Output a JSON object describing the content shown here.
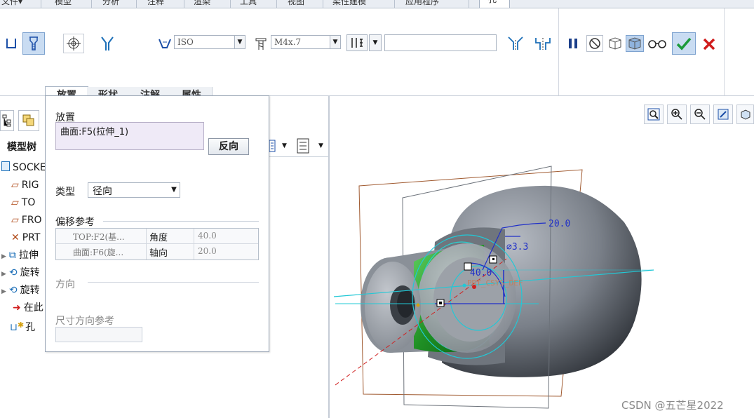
{
  "menu": {
    "tabs": [
      "文件▾",
      "模型",
      "分析",
      "注释",
      "渲染",
      "工具",
      "视图",
      "柔性建模",
      "应用程序",
      "孔"
    ]
  },
  "ribbon": {
    "standard_combo": "ISO",
    "size_combo": "M4x.7",
    "depth_value": ""
  },
  "subtabs": [
    "放置",
    "形状",
    "注解",
    "属性"
  ],
  "tree": {
    "title": "模型树",
    "items": [
      "SOCKE",
      "RIG",
      "TO",
      "FRO",
      "PRT",
      "拉伸",
      "旋转",
      "旋转",
      "在此",
      "孔"
    ]
  },
  "panel": {
    "placement_label": "放置",
    "placement_ref": "曲面:F5(拉伸_1)",
    "flip_button": "反向",
    "type_label": "类型",
    "type_value": "径向",
    "offset_label": "偏移参考",
    "offset_rows": [
      {
        "ref": "TOP:F2(基...",
        "kind": "角度",
        "value": "40.0"
      },
      {
        "ref": "曲面:F6(旋...",
        "kind": "轴向",
        "value": "20.0"
      }
    ],
    "direction_label": "方向",
    "dim_ref_label": "尺寸方向参考"
  },
  "viewport": {
    "dim_axial": "20.0",
    "dim_diameter": "3.3",
    "dim_angle": "40.0",
    "csys_label": "PRT_CSYS_DEF"
  },
  "watermark": "CSDN @五芒星2022"
}
